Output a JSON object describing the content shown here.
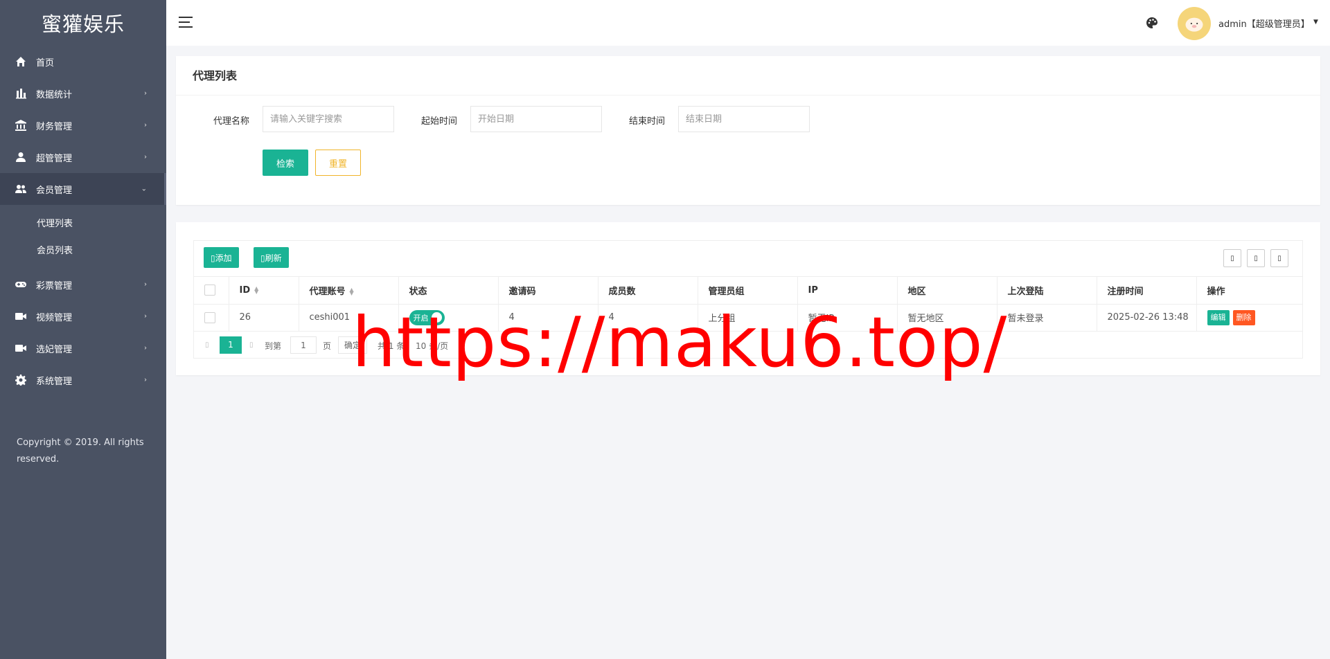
{
  "sidebar": {
    "brand": "蜜獾娱乐",
    "items": [
      {
        "label": "首页",
        "icon": "home-icon"
      },
      {
        "label": "数据统计",
        "icon": "bar-chart-icon"
      },
      {
        "label": "财务管理",
        "icon": "bank-icon"
      },
      {
        "label": "超管管理",
        "icon": "user-icon"
      },
      {
        "label": "会员管理",
        "icon": "users-icon"
      },
      {
        "label": "彩票管理",
        "icon": "gamepad-icon"
      },
      {
        "label": "视频管理",
        "icon": "video-icon"
      },
      {
        "label": "选妃管理",
        "icon": "video-icon"
      },
      {
        "label": "系统管理",
        "icon": "gear-icon"
      }
    ],
    "sub_items": [
      {
        "label": "代理列表"
      },
      {
        "label": "会员列表"
      }
    ],
    "copyright": "Copyright © 2019. All rights reserved."
  },
  "header": {
    "user": "admin【超级管理员】"
  },
  "search": {
    "title": "代理列表",
    "name_label": "代理名称",
    "name_placeholder": "请输入关键字搜索",
    "start_label": "起始时间",
    "start_placeholder": "开始日期",
    "end_label": "结束时间",
    "end_placeholder": "结束日期",
    "search_btn": "检索",
    "reset_btn": "重置"
  },
  "toolbar": {
    "add_label": "添加",
    "refresh_label": "刷新"
  },
  "table": {
    "columns": [
      "ID",
      "代理账号",
      "状态",
      "邀请码",
      "成员数",
      "管理员组",
      "IP",
      "地区",
      "上次登陆",
      "注册时间",
      "操作"
    ],
    "rows": [
      {
        "id": "26",
        "account": "ceshi001",
        "status": "开启",
        "invite_code": "4",
        "members": "4",
        "admin_group": "上分组",
        "ip": "暂无IP",
        "region": "暂无地区",
        "last_login": "暂未登录",
        "reg_time": "2025-02-26 13:48",
        "edit": "编辑",
        "delete": "删除"
      }
    ]
  },
  "pager": {
    "current": "1",
    "goto_label": "到第",
    "goto_value": "1",
    "page_unit": "页",
    "confirm": "确定",
    "total": "共 1 条",
    "per_page": "10 条/页"
  },
  "watermark": "https://maku6.top/",
  "colors": {
    "sidebar_bg": "#4a5263",
    "accent": "#1ab394",
    "warning": "#f0b429",
    "danger": "#ff5722",
    "watermark": "#ff0000"
  }
}
